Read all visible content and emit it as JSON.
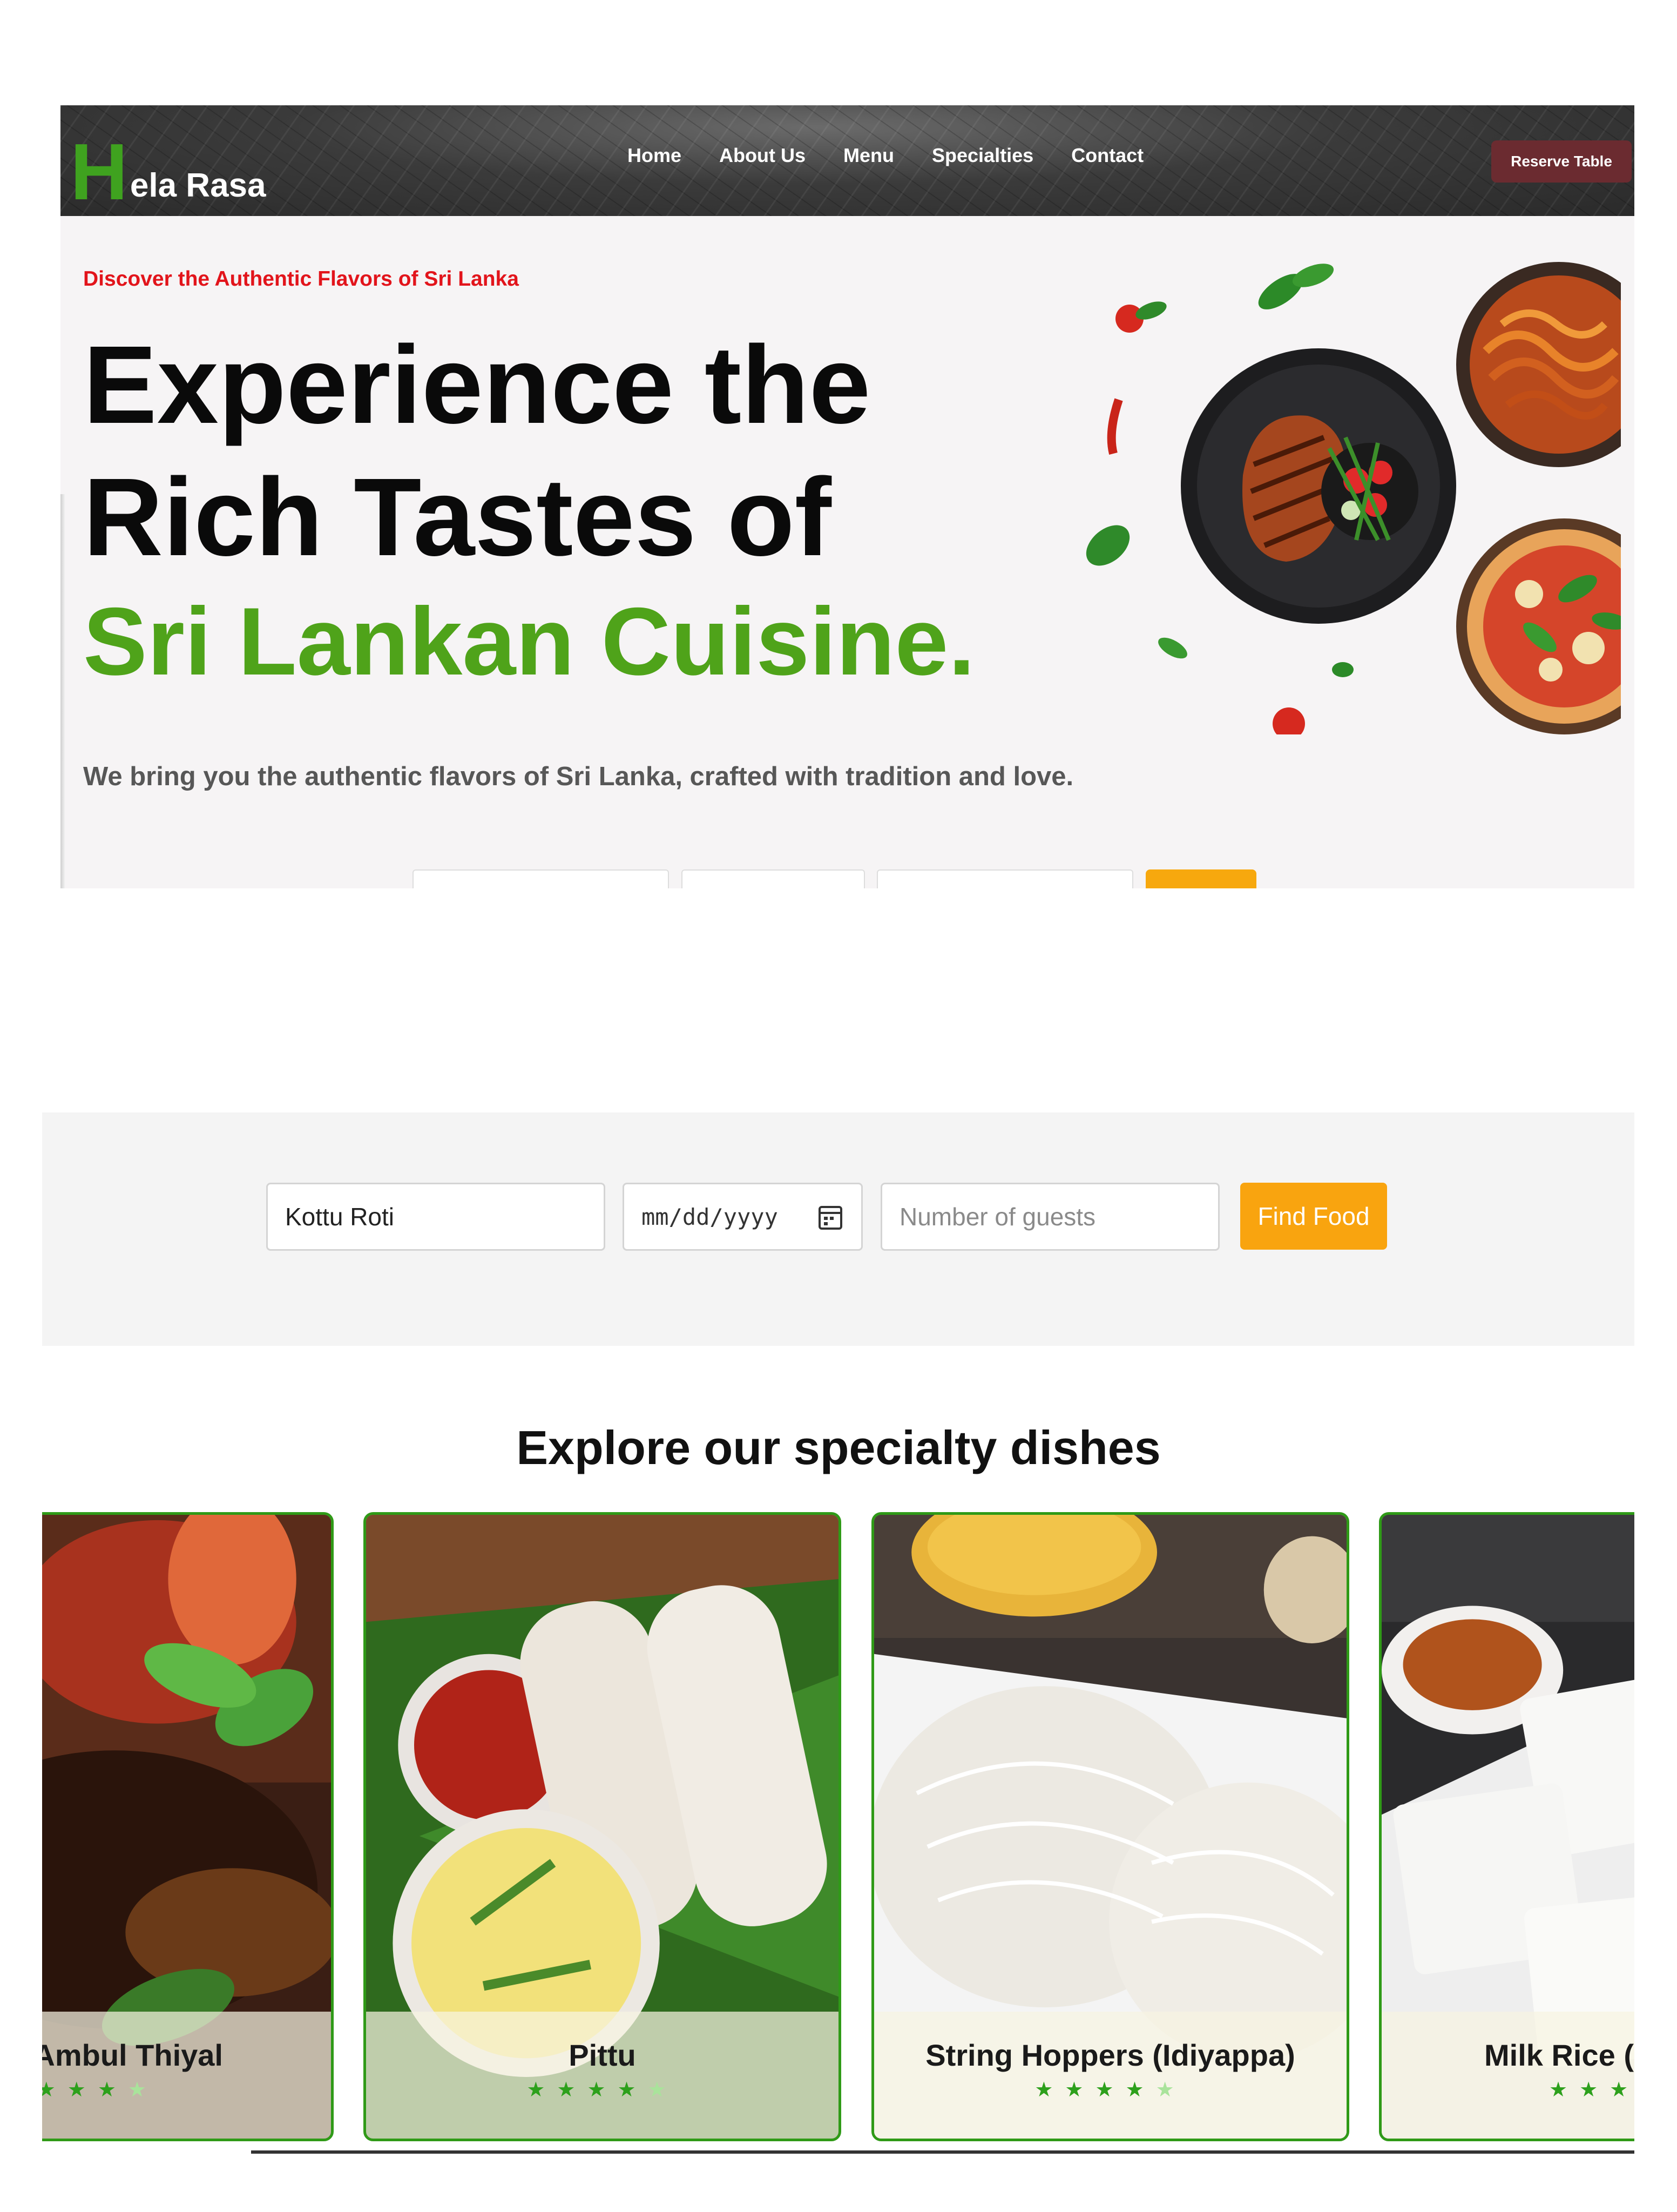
{
  "nav": {
    "logo_initial": "H",
    "logo_rest": "ela Rasa",
    "links": [
      "Home",
      "About Us",
      "Menu",
      "Specialties",
      "Contact"
    ],
    "reserve_label": "Reserve Table"
  },
  "hero": {
    "eyebrow": "Discover the Authentic Flavors of Sri Lanka",
    "headline_line1": "Experience the",
    "headline_line2": "Rich Tastes of",
    "headline_line3": "Sri Lankan Cuisine.",
    "subtitle": "We bring you the authentic flavors of Sri Lanka, crafted with tradition and love."
  },
  "search": {
    "dish_value": "Kottu Roti",
    "date_placeholder": "mm/dd/yyyy",
    "guests_placeholder": "Number of guests",
    "find_label": "Find Food"
  },
  "specialties": {
    "title": "Explore our specialty dishes",
    "dishes": [
      {
        "name": "Ambul Thiyal",
        "rating": 4
      },
      {
        "name": "Pittu",
        "rating": 4
      },
      {
        "name": "String Hoppers (Idiyappa)",
        "rating": 4
      },
      {
        "name": "Milk Rice (K",
        "rating": 4
      }
    ]
  },
  "colors": {
    "accent_green": "#4fa31a",
    "eyebrow_red": "#e2141b",
    "reserve_button": "#6b2b30",
    "find_button": "#f9a40f",
    "card_border": "#2f9a17"
  },
  "icons": [
    "calendar-icon",
    "star-icon"
  ]
}
